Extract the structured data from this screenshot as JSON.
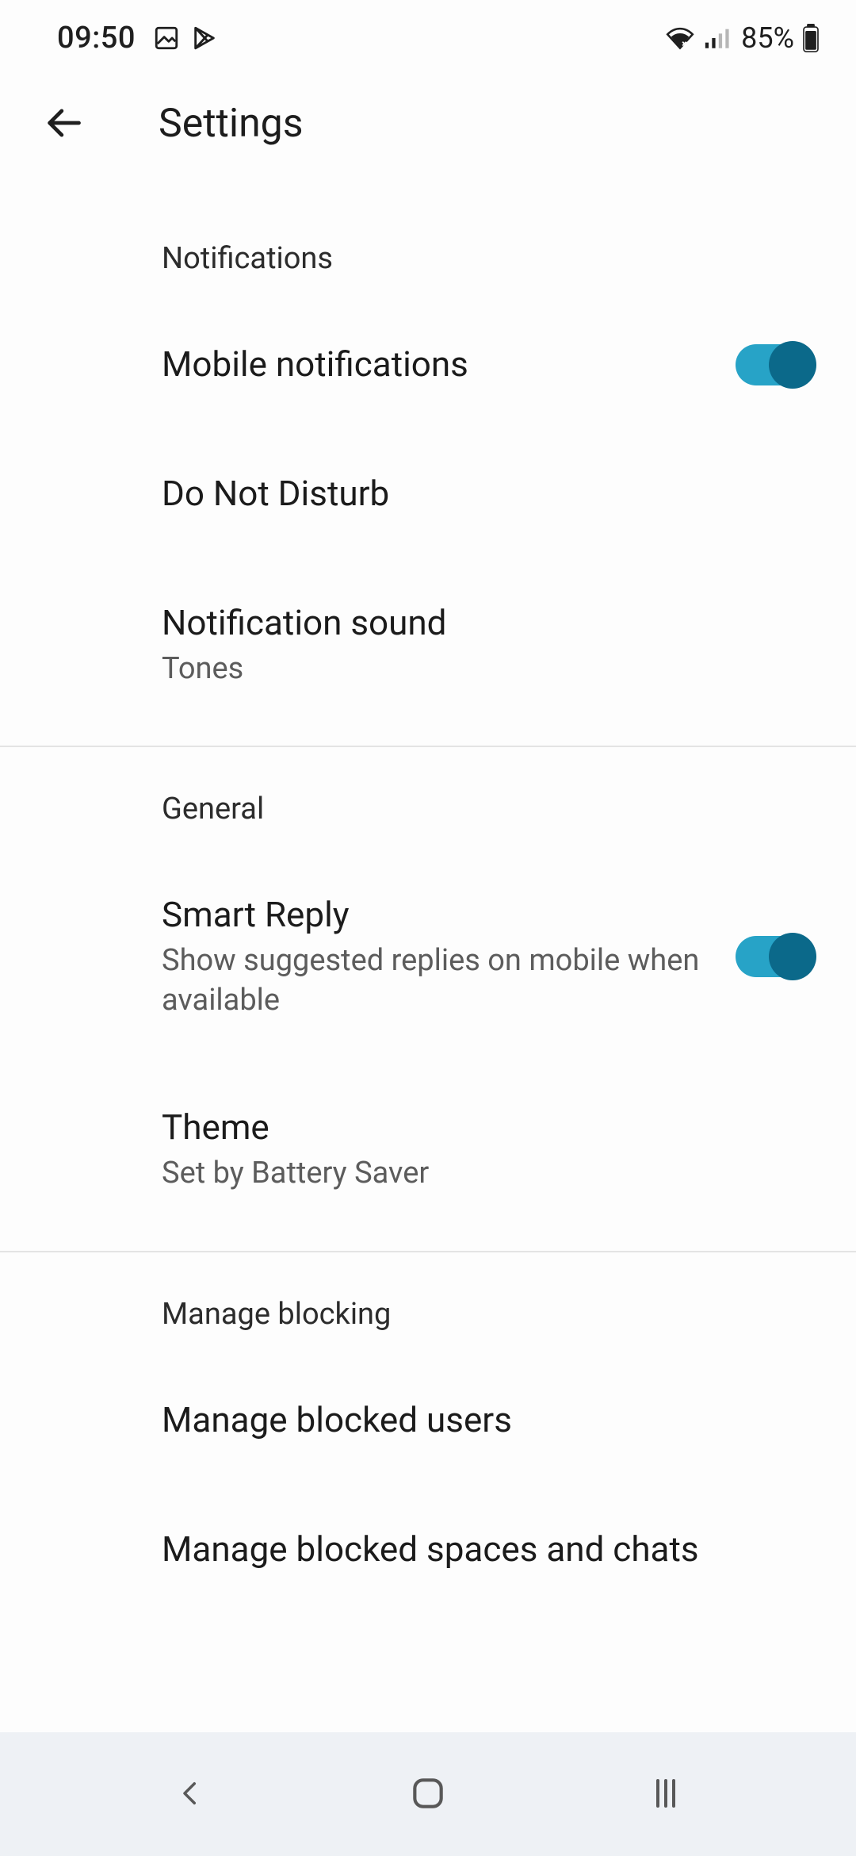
{
  "status": {
    "time": "09:50",
    "battery_pct": "85%"
  },
  "header": {
    "title": "Settings"
  },
  "sections": {
    "notifications": {
      "header": "Notifications",
      "mobile_notifications": {
        "title": "Mobile notifications",
        "on": true
      },
      "do_not_disturb": {
        "title": "Do Not Disturb"
      },
      "notification_sound": {
        "title": "Notification sound",
        "subtitle": "Tones"
      }
    },
    "general": {
      "header": "General",
      "smart_reply": {
        "title": "Smart Reply",
        "subtitle": "Show suggested replies on mobile when available",
        "on": true
      },
      "theme": {
        "title": "Theme",
        "subtitle": "Set by Battery Saver"
      }
    },
    "blocking": {
      "header": "Manage blocking",
      "blocked_users": {
        "title": "Manage blocked users"
      },
      "blocked_spaces": {
        "title": "Manage blocked spaces and chats"
      }
    }
  }
}
